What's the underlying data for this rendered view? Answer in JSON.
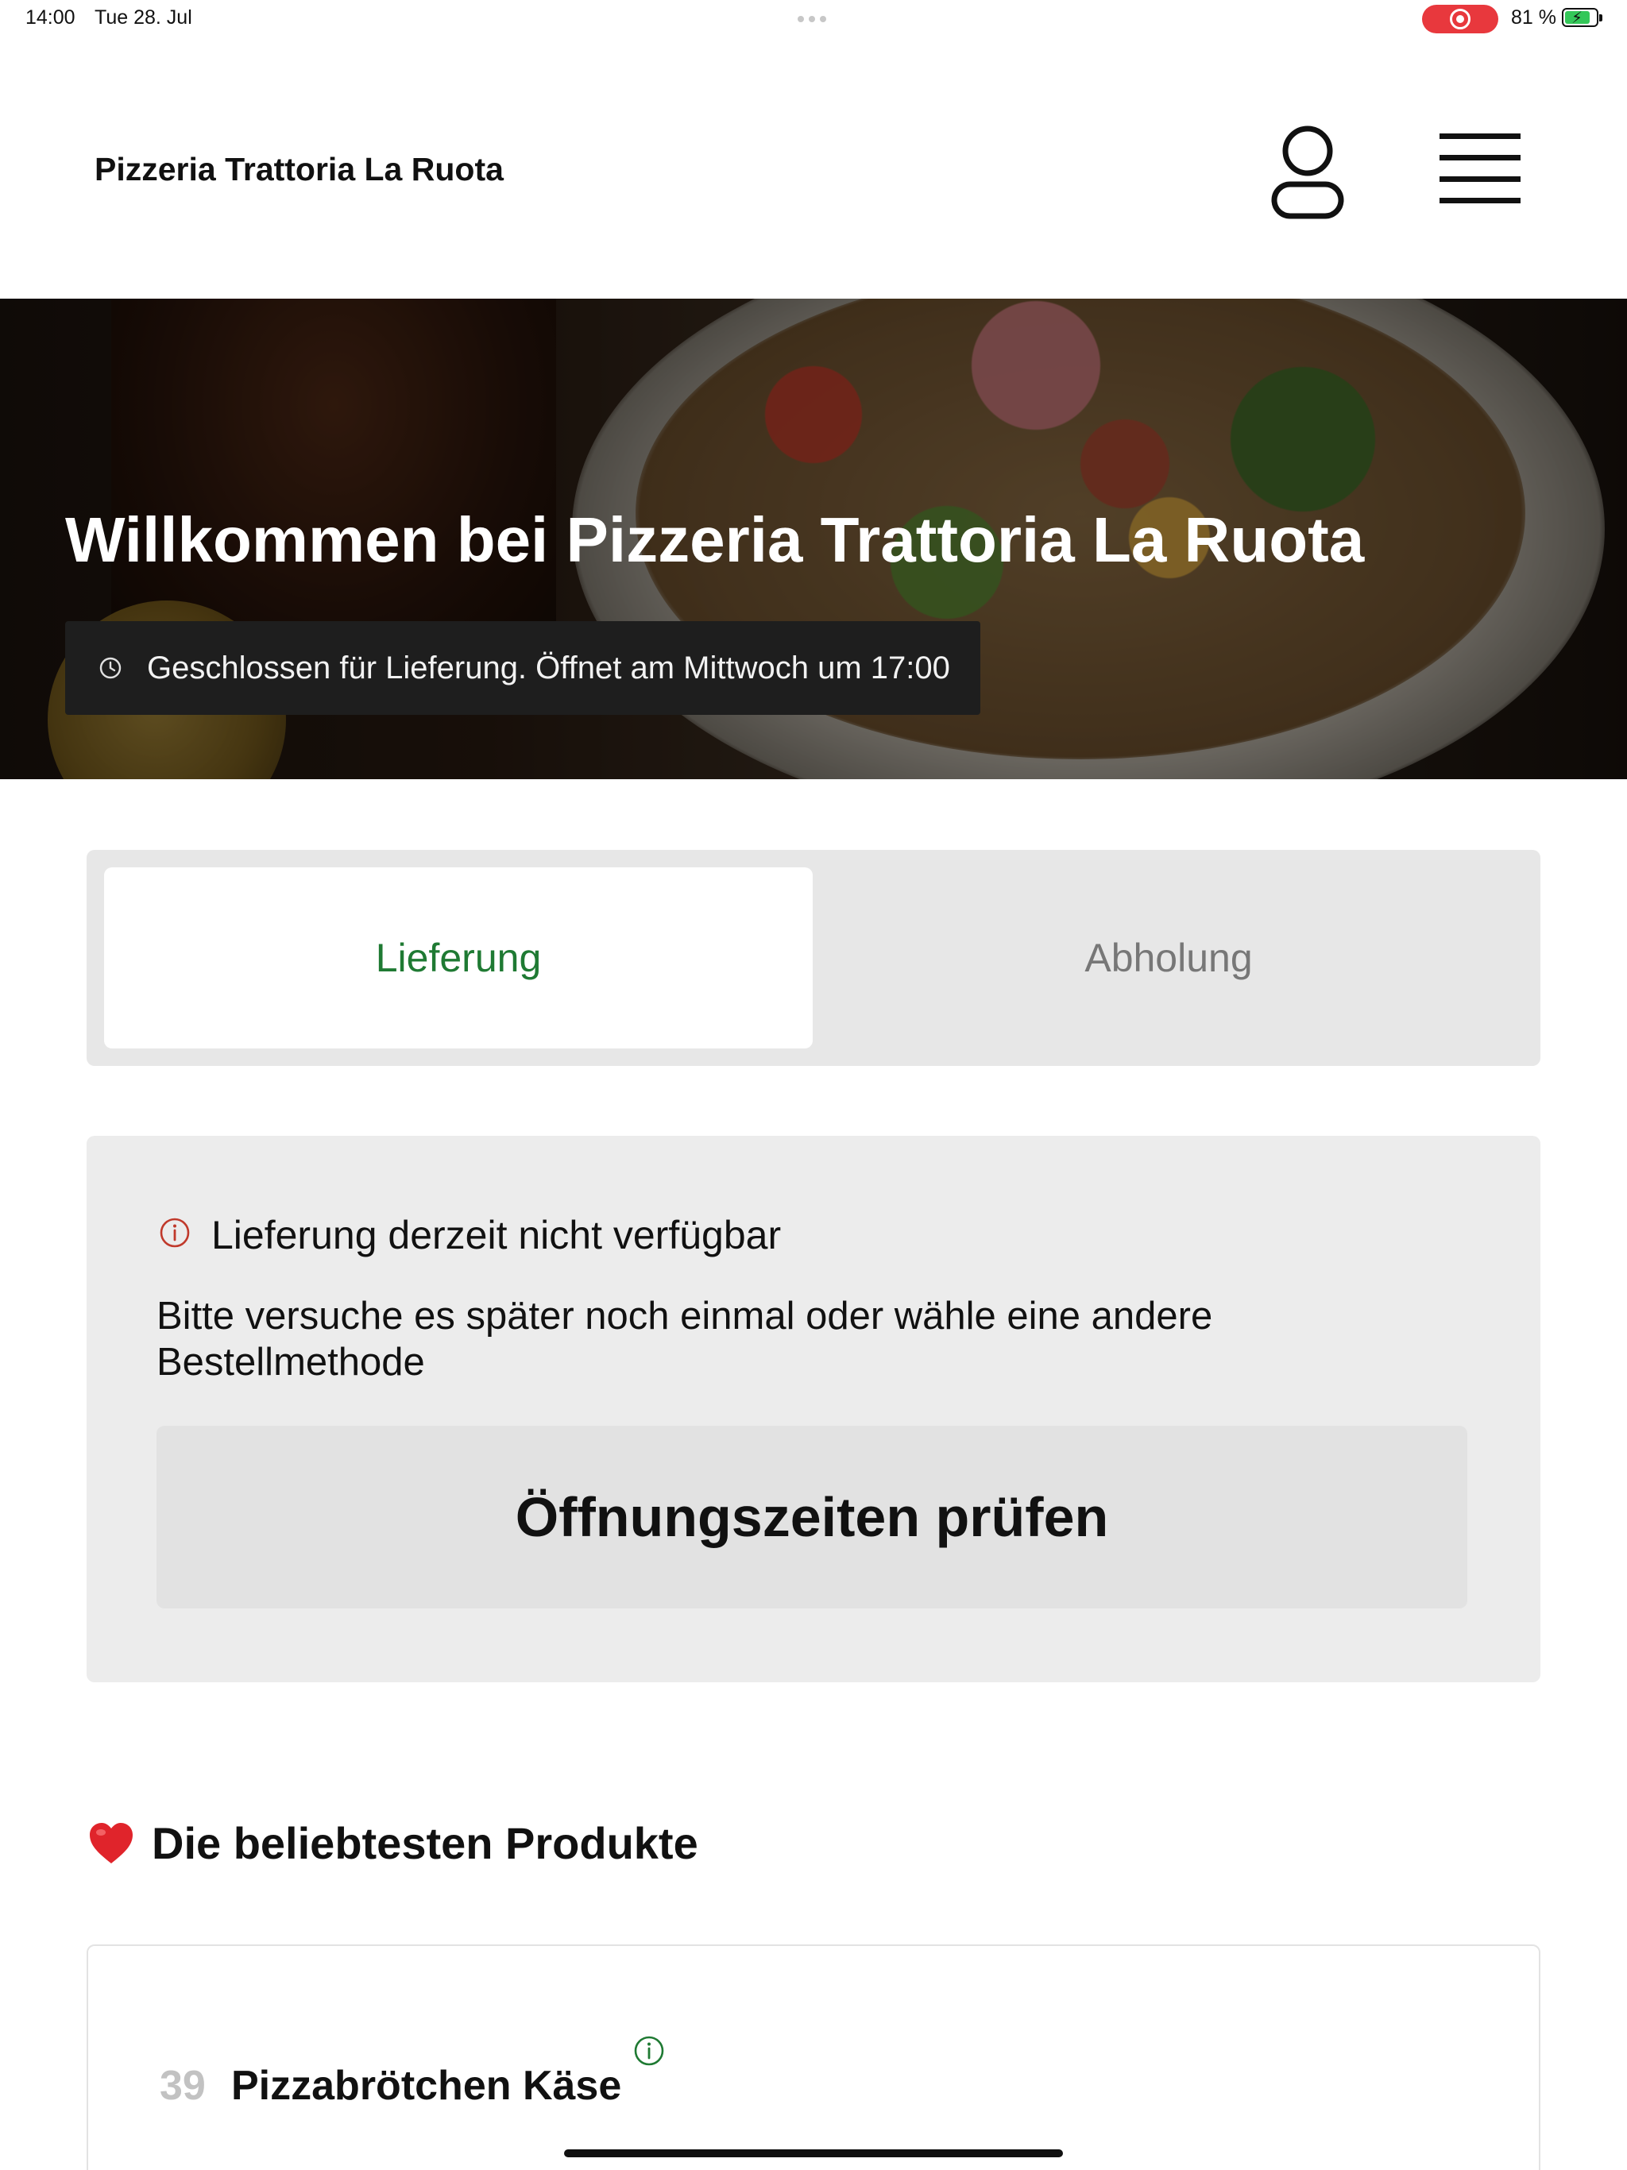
{
  "status_bar": {
    "time": "14:00",
    "date": "Tue 28. Jul",
    "battery_percent": "81 %",
    "battery_level": 0.81,
    "recording_active": true
  },
  "header": {
    "brand": "Pizzeria Trattoria La Ruota",
    "account_icon": "person-icon",
    "menu_icon": "hamburger-icon"
  },
  "hero": {
    "title": "Willkommen bei Pizzeria Trattoria La Ruota",
    "status_icon": "clock-icon",
    "status_text": "Geschlossen für Lieferung. Öffnet am Mittwoch um 17:00"
  },
  "order_method": {
    "options": [
      {
        "label": "Lieferung",
        "selected": true
      },
      {
        "label": "Abholung",
        "selected": false
      }
    ],
    "active_color": "#1f7a33"
  },
  "notice": {
    "icon": "info-icon",
    "icon_color": "#c0392b",
    "title": "Lieferung derzeit nicht verfügbar",
    "body": "Bitte versuche es später noch einmal oder wähle eine andere Bestellmethode",
    "button": "Öffnungszeiten prüfen"
  },
  "popular": {
    "icon": "heart-icon",
    "title": "Die beliebtesten Produkte",
    "products": [
      {
        "number": "39",
        "name": "Pizzabrötchen Käse",
        "info_icon": "info-icon"
      }
    ]
  }
}
